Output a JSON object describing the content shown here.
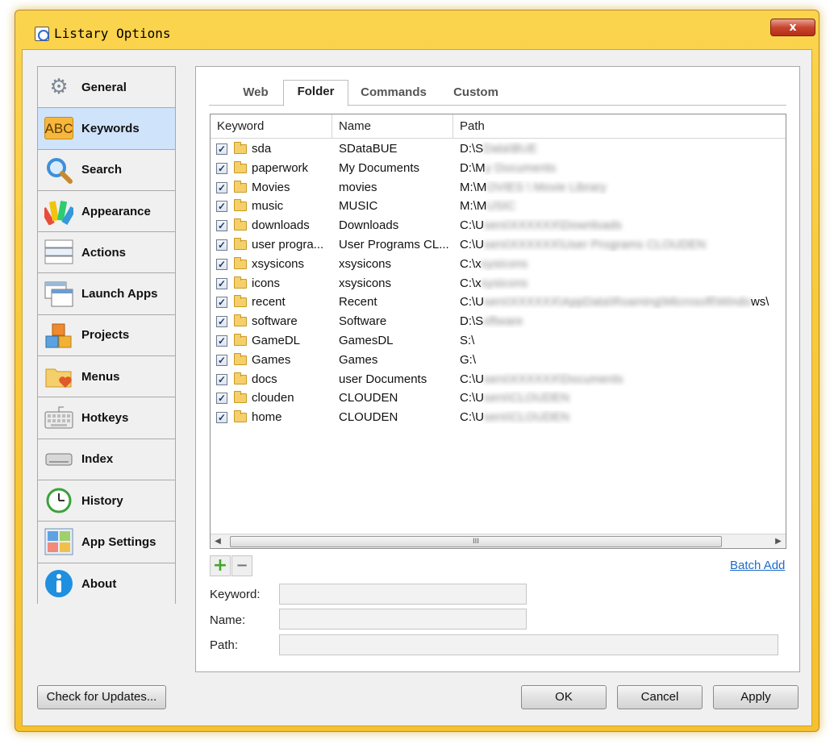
{
  "window": {
    "title": "Listary Options",
    "close_label": "x"
  },
  "sidebar": {
    "items": [
      {
        "label": "General",
        "icon": "gear-icon",
        "active": false
      },
      {
        "label": "Keywords",
        "icon": "abc-icon",
        "glyph": "ABC",
        "active": true
      },
      {
        "label": "Search",
        "icon": "magnifier-icon",
        "active": false
      },
      {
        "label": "Appearance",
        "icon": "palette-icon",
        "active": false
      },
      {
        "label": "Actions",
        "icon": "actions-icon",
        "active": false
      },
      {
        "label": "Launch Apps",
        "icon": "windows-icon",
        "active": false
      },
      {
        "label": "Projects",
        "icon": "blocks-icon",
        "active": false
      },
      {
        "label": "Menus",
        "icon": "folder-heart-icon",
        "active": false
      },
      {
        "label": "Hotkeys",
        "icon": "keyboard-icon",
        "active": false
      },
      {
        "label": "Index",
        "icon": "drive-icon",
        "active": false
      },
      {
        "label": "History",
        "icon": "clock-icon",
        "active": false
      },
      {
        "label": "App Settings",
        "icon": "app-settings-icon",
        "active": false
      },
      {
        "label": "About",
        "icon": "info-icon",
        "active": false
      }
    ]
  },
  "tabs": [
    {
      "label": "Web",
      "active": false
    },
    {
      "label": "Folder",
      "active": true
    },
    {
      "label": "Commands",
      "active": false
    },
    {
      "label": "Custom",
      "active": false
    }
  ],
  "table": {
    "columns": [
      "Keyword",
      "Name",
      "Path"
    ],
    "rows": [
      {
        "checked": true,
        "keyword": "sda",
        "name": "SDataBUE",
        "path": "D:\\S",
        "path_hidden": "Data\\BUE"
      },
      {
        "checked": true,
        "keyword": "paperwork",
        "name": "My Documents",
        "path": "D:\\M",
        "path_hidden": "y Documents"
      },
      {
        "checked": true,
        "keyword": "Movies",
        "name": "movies",
        "path": "M:\\M",
        "path_hidden": "OVIES \\ Movie Library"
      },
      {
        "checked": true,
        "keyword": "music",
        "name": "MUSIC",
        "path": "M:\\M",
        "path_hidden": "USIC"
      },
      {
        "checked": true,
        "keyword": "downloads",
        "name": "Downloads",
        "path": "C:\\U",
        "path_hidden": "sers\\XXXXXX\\Downloads"
      },
      {
        "checked": true,
        "keyword": "user progra...",
        "name": "User Programs CL...",
        "path": "C:\\U",
        "path_hidden": "sers\\XXXXXX\\User Programs CLOUDEN"
      },
      {
        "checked": true,
        "keyword": "xsysicons",
        "name": "xsysicons",
        "path": "C:\\x",
        "path_hidden": "sysicons"
      },
      {
        "checked": true,
        "keyword": "icons",
        "name": "xsysicons",
        "path": "C:\\x",
        "path_hidden": "sysicons"
      },
      {
        "checked": true,
        "keyword": "recent",
        "name": "Recent",
        "path": "C:\\U",
        "path_hidden": "sers\\XXXXXX\\AppData\\Roaming\\Microsoft\\Windo",
        "path_tail": "ws\\"
      },
      {
        "checked": true,
        "keyword": "software",
        "name": "Software",
        "path": "D:\\S",
        "path_hidden": "oftware"
      },
      {
        "checked": true,
        "keyword": "GameDL",
        "name": "GamesDL",
        "path": "S:\\",
        "path_hidden": ""
      },
      {
        "checked": true,
        "keyword": "Games",
        "name": "Games",
        "path": "G:\\",
        "path_hidden": ""
      },
      {
        "checked": true,
        "keyword": "docs",
        "name": "user Documents",
        "path": "C:\\U",
        "path_hidden": "sers\\XXXXXX\\Documents"
      },
      {
        "checked": true,
        "keyword": "clouden",
        "name": "CLOUDEN",
        "path": "C:\\U",
        "path_hidden": "sers\\CLOUDEN"
      },
      {
        "checked": true,
        "keyword": "home",
        "name": "CLOUDEN",
        "path": "C:\\U",
        "path_hidden": "sers\\CLOUDEN"
      }
    ],
    "scroll_grip": "III"
  },
  "actions": {
    "add": "+",
    "remove": "−",
    "batch_add": "Batch Add"
  },
  "form": {
    "keyword_label": "Keyword:",
    "keyword_value": "",
    "name_label": "Name:",
    "name_value": "",
    "path_label": "Path:",
    "path_value": ""
  },
  "footer": {
    "check_updates": "Check for Updates...",
    "ok": "OK",
    "cancel": "Cancel",
    "apply": "Apply"
  },
  "colors": {
    "title_bar": "#f8c93a",
    "selected_nav": "#cfe3fb",
    "link": "#1e6bc9",
    "close_button": "#c9452d"
  }
}
